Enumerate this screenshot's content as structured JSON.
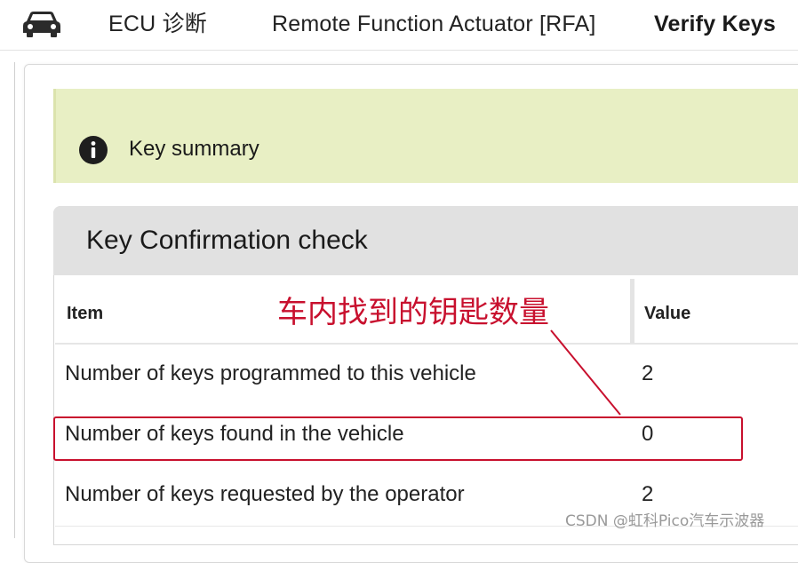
{
  "breadcrumb": {
    "home_icon": "car-icon",
    "items": [
      "ECU 诊断",
      "Remote Function Actuator [RFA]",
      "Verify Keys"
    ]
  },
  "info_banner": {
    "icon": "info-icon",
    "text": "Key summary",
    "background_color": "#e8efc4"
  },
  "panel": {
    "title": "Key Confirmation check",
    "table": {
      "headers": [
        "Item",
        "Value"
      ],
      "rows": [
        {
          "item": "Number of keys programmed to this vehicle",
          "value": "2"
        },
        {
          "item": "Number of keys found in the vehicle",
          "value": "0"
        },
        {
          "item": "Number of keys requested by the operator",
          "value": "2"
        }
      ]
    }
  },
  "annotation": {
    "callout_text": "车内找到的钥匙数量",
    "color": "#c8102e"
  },
  "watermark": "CSDN @虹科Pico汽车示波器"
}
